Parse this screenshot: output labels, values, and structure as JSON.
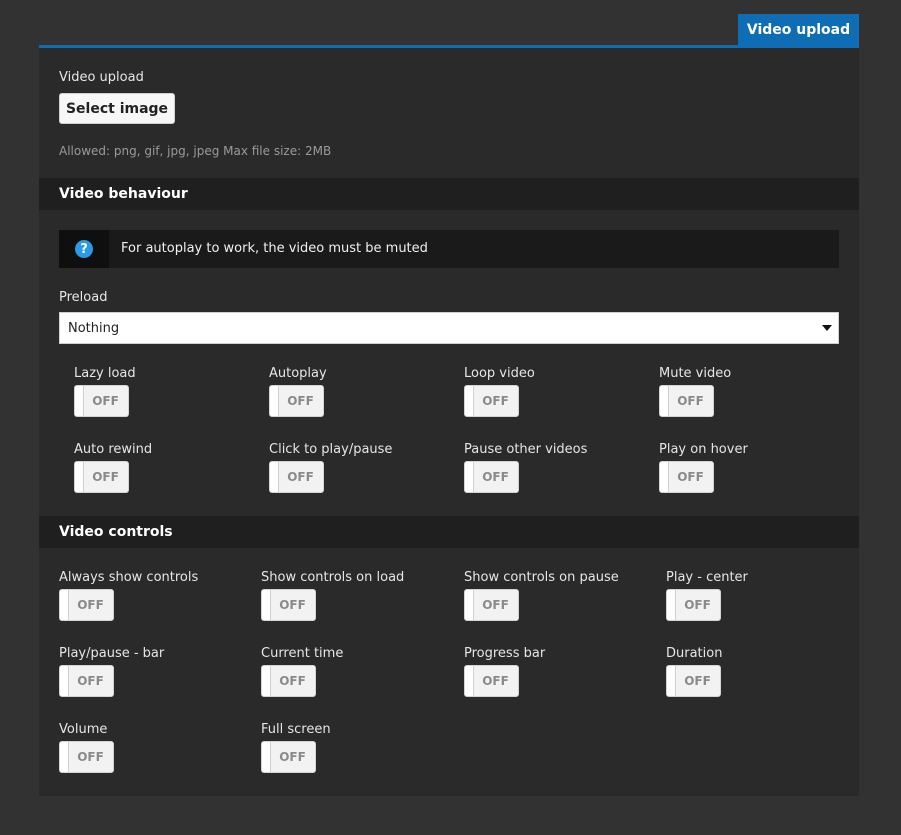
{
  "tab": {
    "label": "Video upload"
  },
  "upload": {
    "label": "Video upload",
    "button_label": "Select image",
    "hint": "Allowed: png, gif, jpg, jpeg Max file size: 2MB"
  },
  "behaviour": {
    "title": "Video behaviour",
    "notice": "For autoplay to work, the video must be muted",
    "preload_label": "Preload",
    "preload_value": "Nothing",
    "toggles": [
      {
        "label": "Lazy load",
        "state": "OFF"
      },
      {
        "label": "Autoplay",
        "state": "OFF"
      },
      {
        "label": "Loop video",
        "state": "OFF"
      },
      {
        "label": "Mute video",
        "state": "OFF"
      },
      {
        "label": "Auto rewind",
        "state": "OFF"
      },
      {
        "label": "Click to play/pause",
        "state": "OFF"
      },
      {
        "label": "Pause other videos",
        "state": "OFF"
      },
      {
        "label": "Play on hover",
        "state": "OFF"
      }
    ]
  },
  "controls": {
    "title": "Video controls",
    "toggles": [
      {
        "label": "Always show controls",
        "state": "OFF"
      },
      {
        "label": "Show controls on load",
        "state": "OFF"
      },
      {
        "label": "Show controls on pause",
        "state": "OFF"
      },
      {
        "label": "Play - center",
        "state": "OFF"
      },
      {
        "label": "Play/pause - bar",
        "state": "OFF"
      },
      {
        "label": "Current time",
        "state": "OFF"
      },
      {
        "label": "Progress bar",
        "state": "OFF"
      },
      {
        "label": "Duration",
        "state": "OFF"
      },
      {
        "label": "Volume",
        "state": "OFF"
      },
      {
        "label": "Full screen",
        "state": "OFF"
      }
    ]
  }
}
